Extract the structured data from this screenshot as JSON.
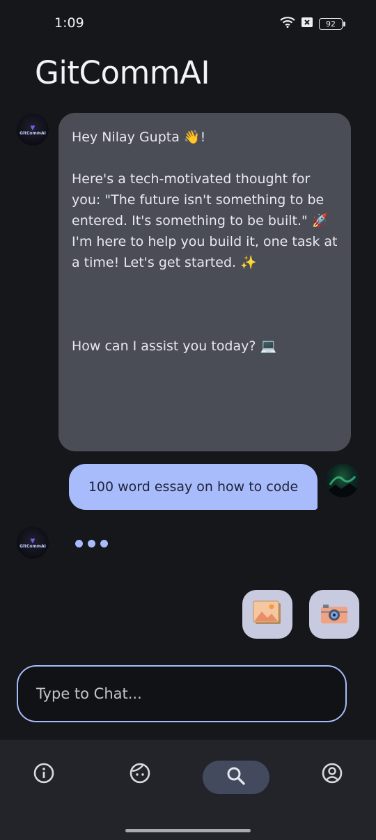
{
  "status_bar": {
    "time": "1:09",
    "battery": "92",
    "icons": [
      "wifi-icon",
      "sim-off-icon",
      "battery-icon"
    ]
  },
  "app": {
    "title": "GitCommAI"
  },
  "chat": {
    "bot_avatar_label": "GitCommAI",
    "messages": [
      {
        "sender": "bot",
        "text": "Hey Nilay Gupta 👋!\n\nHere's a tech-motivated thought for you: \"The future isn't something to be entered. It's something to be built.\" 🚀 I'm here to help you build it, one task at a time! Let's get started. ✨\n\n\n\nHow can I assist you today? 💻"
      },
      {
        "sender": "user",
        "text": "100 word essay on how to code"
      }
    ],
    "typing_indicator": true
  },
  "actions": {
    "image_button_icon": "image-gallery-icon",
    "camera_button_icon": "camera-icon"
  },
  "input": {
    "placeholder": "Type to Chat..."
  },
  "bottom_nav": {
    "items": [
      {
        "name": "info",
        "icon": "info-icon",
        "active": false
      },
      {
        "name": "face",
        "icon": "face-icon",
        "active": false
      },
      {
        "name": "search",
        "icon": "search-icon",
        "active": true
      },
      {
        "name": "profile",
        "icon": "account-icon",
        "active": false
      }
    ]
  },
  "colors": {
    "background": "#16171b",
    "bot_bubble": "#4a4c56",
    "user_bubble": "#a8bcfb",
    "accent": "#a8bcfb",
    "nav_background": "#232429",
    "nav_active_pill": "#434a5e"
  }
}
